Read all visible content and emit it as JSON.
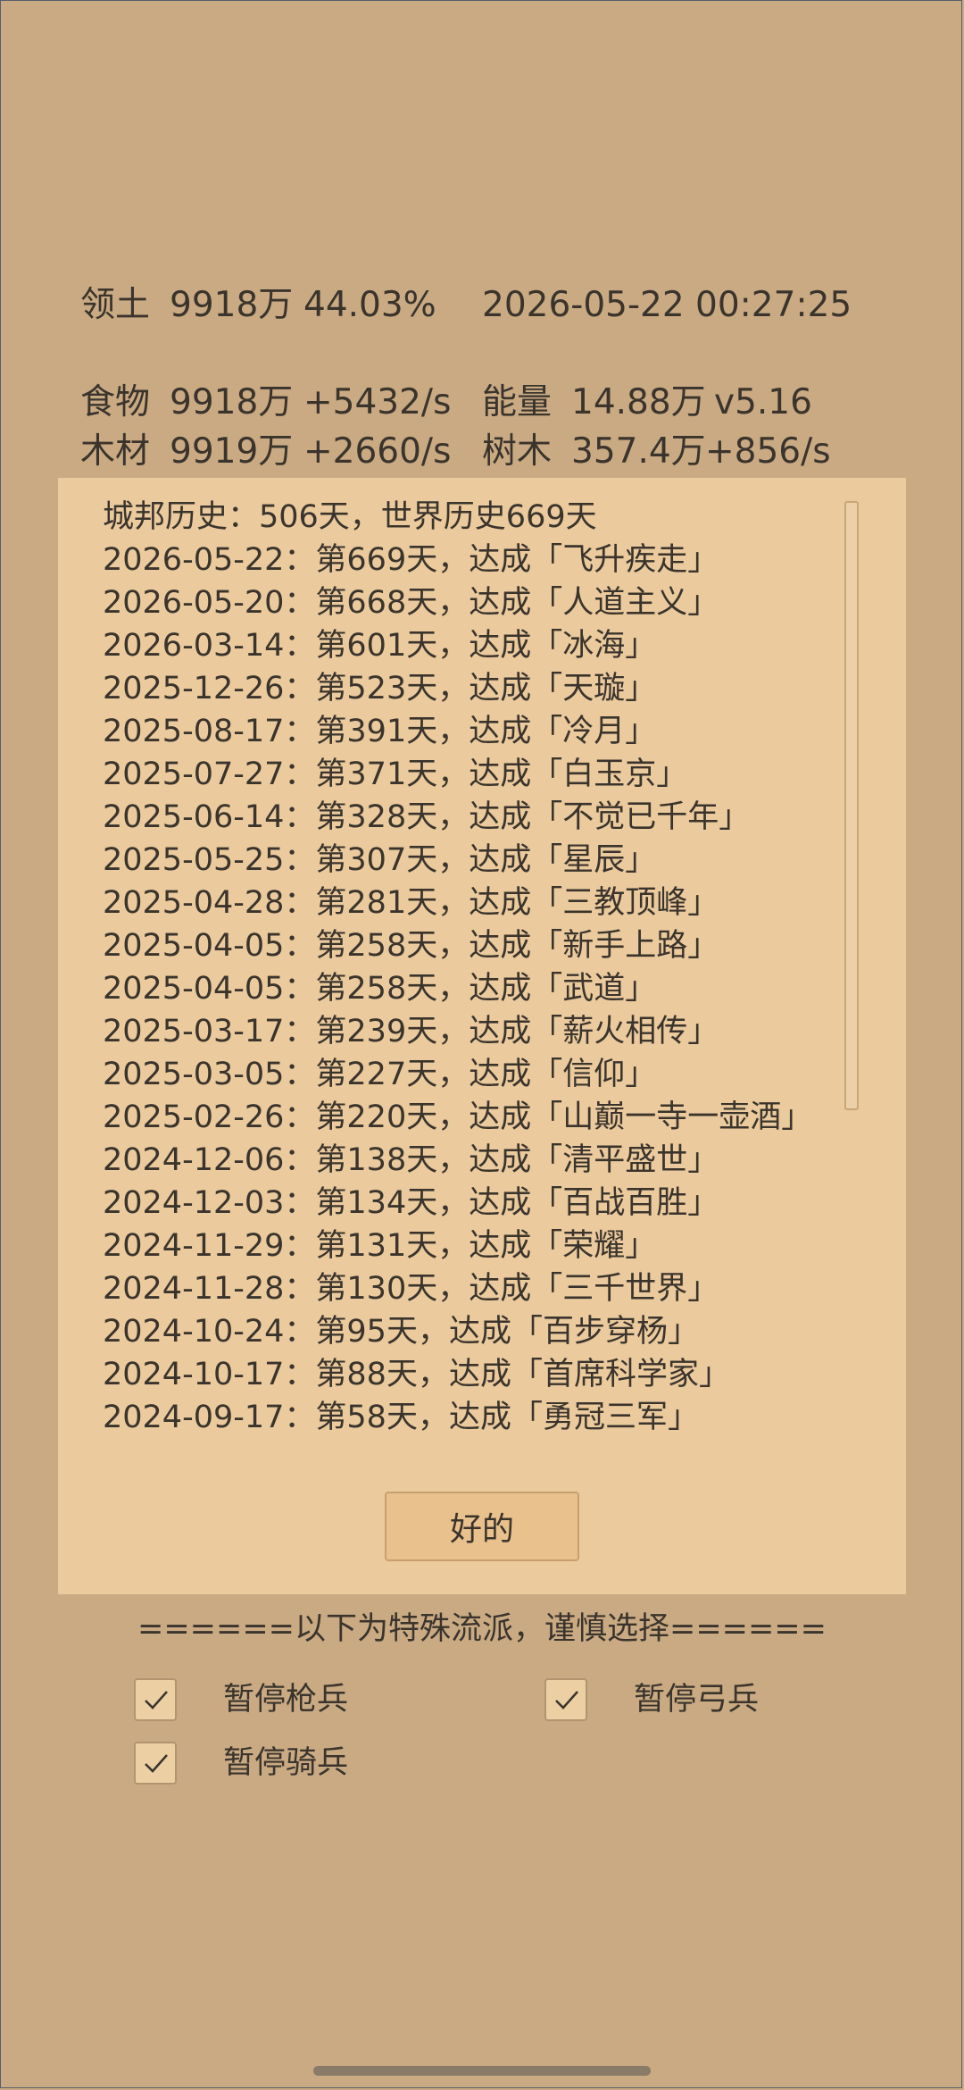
{
  "stats": {
    "territory": {
      "label": "领土",
      "value": "9918万",
      "extra": "44.03%"
    },
    "datetime": "2026-05-22 00:27:25",
    "food": {
      "label": "食物",
      "value": "9918万",
      "rate": "+5432/s"
    },
    "energy": {
      "label": "能量",
      "value": "14.88万",
      "extra": "v5.16"
    },
    "wood": {
      "label": "木材",
      "value": "9919万",
      "rate": "+2660/s"
    },
    "trees": {
      "label": "树木",
      "value": "357.4万",
      "rate": "+856/s"
    }
  },
  "dialog": {
    "header": "城邦历史：506天，世界历史669天",
    "items": [
      "2026-05-22：第669天，达成「飞升疾走」",
      "2026-05-20：第668天，达成「人道主义」",
      "2026-03-14：第601天，达成「冰海」",
      "2025-12-26：第523天，达成「天璇」",
      "2025-08-17：第391天，达成「冷月」",
      "2025-07-27：第371天，达成「白玉京」",
      "2025-06-14：第328天，达成「不觉已千年」",
      "2025-05-25：第307天，达成「星辰」",
      "2025-04-28：第281天，达成「三教顶峰」",
      "2025-04-05：第258天，达成「新手上路」",
      "2025-04-05：第258天，达成「武道」",
      "2025-03-17：第239天，达成「薪火相传」",
      "2025-03-05：第227天，达成「信仰」",
      "2025-02-26：第220天，达成「山巅一寺一壶酒」",
      "2024-12-06：第138天，达成「清平盛世」",
      "2024-12-03：第134天，达成「百战百胜」",
      "2024-11-29：第131天，达成「荣耀」",
      "2024-11-28：第130天，达成「三千世界」",
      "2024-10-24：第95天，达成「百步穿杨」",
      "2024-10-17：第88天，达成「首席科学家」",
      "2024-09-17：第58天，达成「勇冠三军」"
    ],
    "ok_label": "好的"
  },
  "special": {
    "warning": "======以下为特殊流派，谨慎选择======",
    "options": [
      {
        "label": "暂停枪兵",
        "checked": true
      },
      {
        "label": "暂停弓兵",
        "checked": true
      },
      {
        "label": "暂停骑兵",
        "checked": true
      }
    ]
  },
  "colors": {
    "background": "#c9aa83",
    "dialog": "#ebca9d",
    "button": "#e8c18c",
    "text": "#3a342c"
  }
}
